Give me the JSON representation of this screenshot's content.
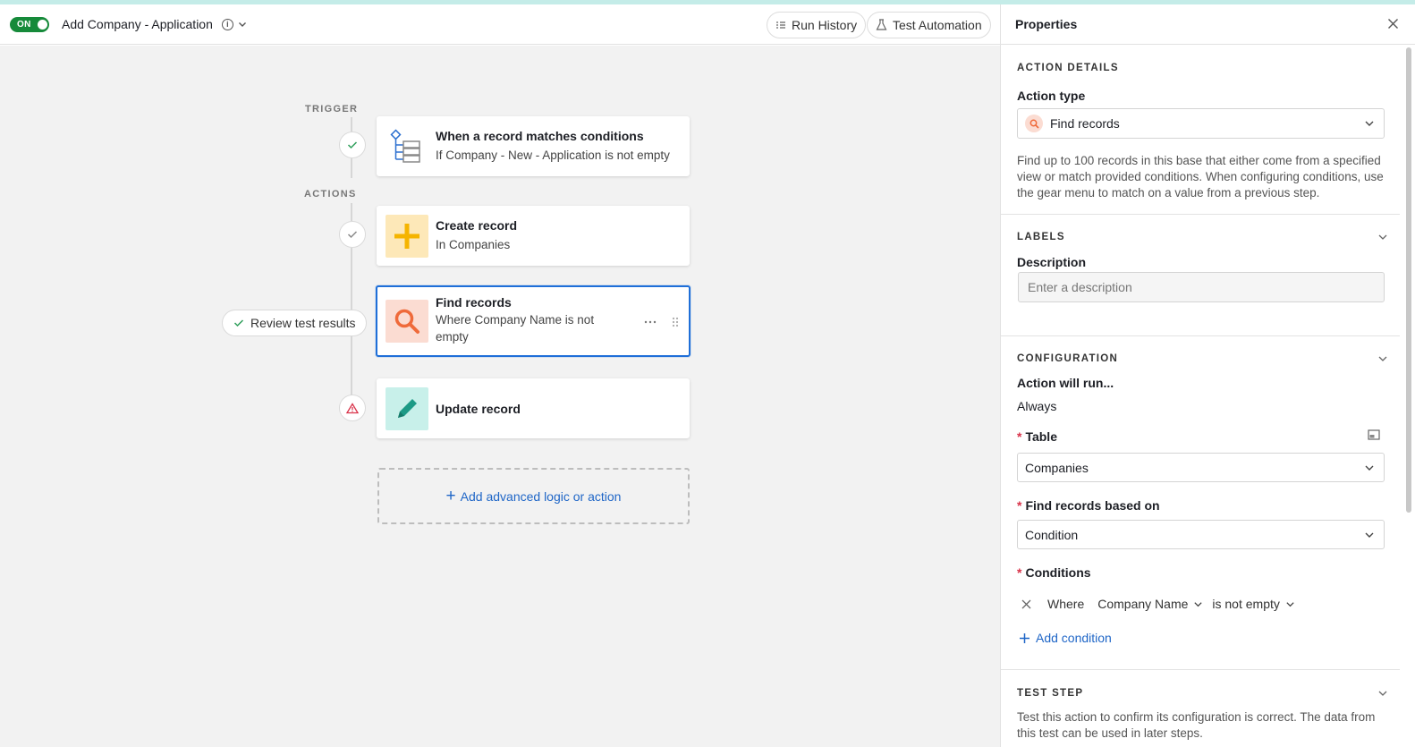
{
  "header": {
    "toggle_label": "ON",
    "automation_title": "Add Company - Application",
    "info_icon": "info-icon",
    "run_history_label": "Run History",
    "test_automation_label": "Test Automation"
  },
  "canvas": {
    "trigger_label": "TRIGGER",
    "actions_label": "ACTIONS",
    "trigger_card": {
      "title": "When a record matches conditions",
      "subtitle": "If Company - New - Application is not empty",
      "icon": "conditions-tree-icon"
    },
    "cards": [
      {
        "title": "Create record",
        "subtitle": "In Companies",
        "icon": "plus-icon",
        "icon_bg": "#fde8b8",
        "icon_color": "#f5b400"
      },
      {
        "title": "Find records",
        "subtitle_line1": "Where Company Name is not",
        "subtitle_line2": "empty",
        "icon": "search-icon",
        "icon_bg": "#fbdcd2",
        "icon_color": "#ef6a3a"
      },
      {
        "title": "Update record",
        "icon": "pencil-icon",
        "icon_bg": "#c8f0ea",
        "icon_color": "#1d9a86"
      }
    ],
    "review_button_label": "Review test results",
    "add_action_label": "Add advanced logic or action"
  },
  "panel": {
    "title": "Properties",
    "action_details": {
      "heading": "ACTION DETAILS",
      "action_type_label": "Action type",
      "action_type_value": "Find records",
      "description": "Find up to 100 records in this base that either come from a specified view or match provided conditions. When configuring conditions, use the gear menu to match on a value from a previous step."
    },
    "labels": {
      "heading": "LABELS",
      "description_label": "Description",
      "description_placeholder": "Enter a description"
    },
    "configuration": {
      "heading": "CONFIGURATION",
      "run_label": "Action will run...",
      "run_value": "Always",
      "table_label": "Table",
      "table_value": "Companies",
      "based_on_label": "Find records based on",
      "based_on_value": "Condition",
      "conditions_label": "Conditions",
      "condition": {
        "where": "Where",
        "field": "Company Name",
        "operator": "is not empty"
      },
      "add_condition_label": "Add condition"
    },
    "test_step": {
      "heading": "TEST STEP",
      "text_line1": "Test this action to confirm its configuration is correct. The data from",
      "text_line2": "this test can be used in later steps."
    }
  },
  "colors": {
    "accent_blue": "#1f6fd8",
    "toggle_green": "#168a3a",
    "required_red": "#d9334a"
  }
}
